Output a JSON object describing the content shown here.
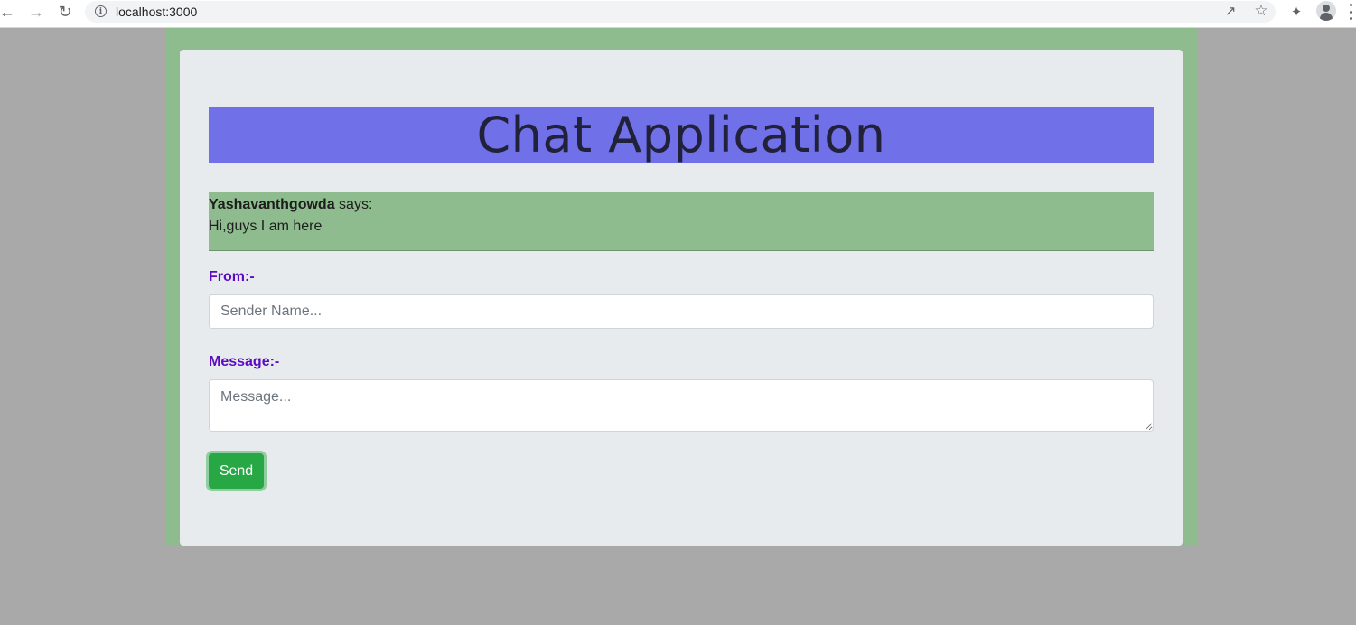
{
  "browser": {
    "url": "localhost:3000",
    "icons": [
      "back-icon",
      "forward-icon",
      "reload-icon",
      "info-icon",
      "share-icon",
      "star-icon",
      "extensions-icon",
      "profile-icon",
      "menu-icon"
    ]
  },
  "app": {
    "title": "Chat Application",
    "messages": [
      {
        "sender": "Yashavanthgowda",
        "says": "says:",
        "text": "Hi,guys I am here"
      }
    ],
    "form": {
      "from_label": "From:-",
      "from_placeholder": "Sender Name...",
      "message_label": "Message:-",
      "message_placeholder": "Message...",
      "send_label": "Send"
    }
  },
  "colors": {
    "page_background": "#a9a9a9",
    "outer_panel": "#8fbc8f",
    "card": "#e8ebee",
    "title_bar": "#7070e8",
    "message_area": "#8fbc8f",
    "label_text": "#5b0bc4",
    "send_button": "#28a745"
  }
}
